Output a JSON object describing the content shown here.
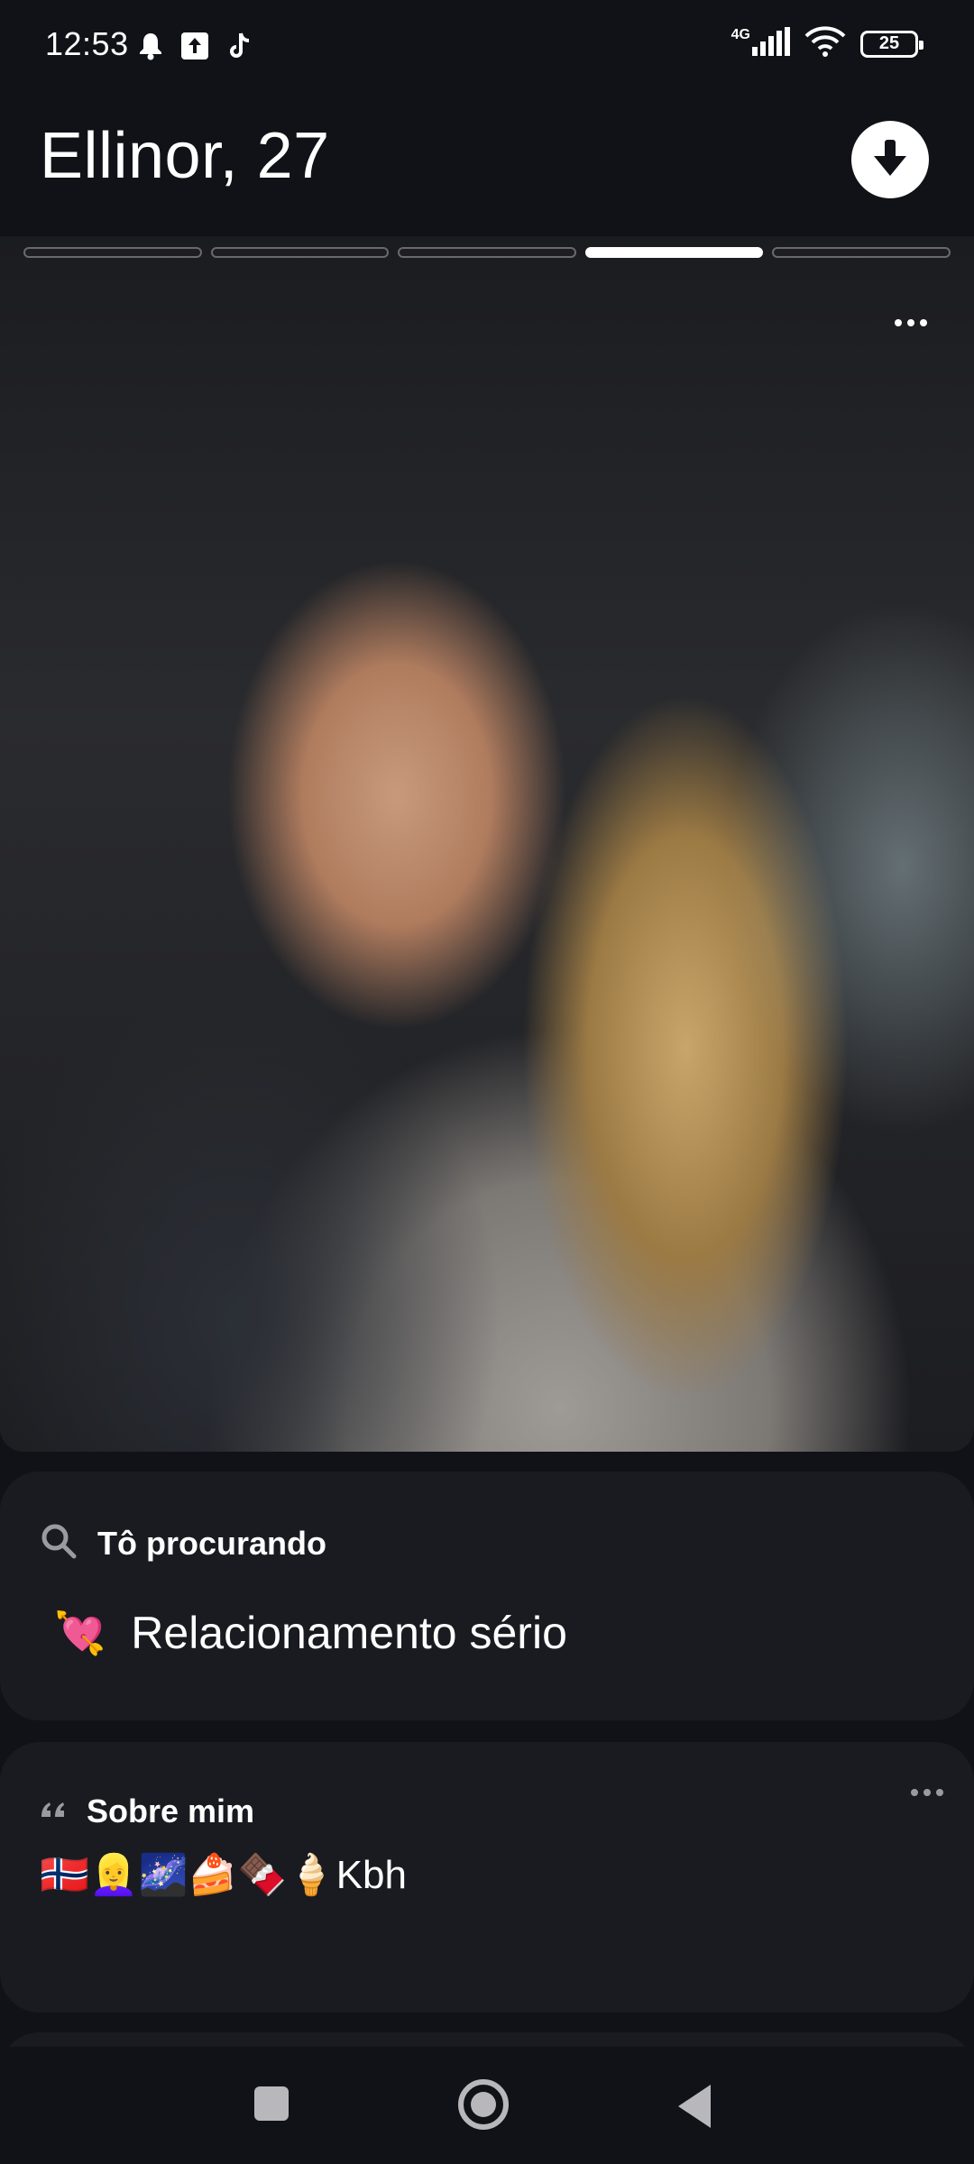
{
  "status_bar": {
    "time": "12:53",
    "network": "4G",
    "battery": "25",
    "icons_left": [
      "bell-icon",
      "upload-icon",
      "tiktok-icon"
    ],
    "icons_right": [
      "signal-icon",
      "wifi-icon",
      "battery-icon"
    ]
  },
  "profile": {
    "name_age": "Ellinor, 27",
    "photo_count": 5,
    "active_photo_index": 3
  },
  "looking_for": {
    "header": "Tô procurando",
    "emoji": "💘",
    "value": "Relacionamento sério"
  },
  "about": {
    "header": "Sobre mim",
    "bio": "🇳🇴👱‍♀️🌌🍰🍫🍦Kbh"
  },
  "colors": {
    "background": "#111217",
    "card": "#1a1b20",
    "accent": "#ffffff",
    "muted_icon": "#9a9ba2"
  }
}
